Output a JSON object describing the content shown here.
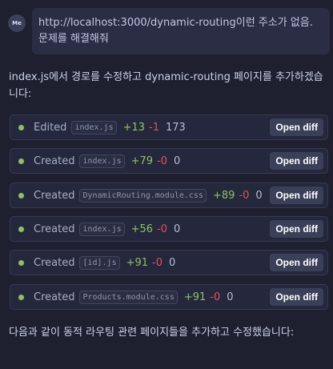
{
  "user": {
    "avatar_label": "Me",
    "message_line1": "http://localhost:3000/dynamic-routing이런 주소가 없음.",
    "message_line2": "문제를 해결해줘"
  },
  "assistant": {
    "intro": "index.js에서 경로를 수정하고 dynamic-routing 페이지를 추가하겠습니다:",
    "outro": "다음과 같이 동적 라우팅 관련 페이지들을 추가하고 수정했습니다:"
  },
  "changes": [
    {
      "action": "Edited",
      "file": "index.js",
      "added": "+13",
      "removed": "-1",
      "total": "173",
      "button": "Open diff"
    },
    {
      "action": "Created",
      "file": "index.js",
      "added": "+79",
      "removed": "-0",
      "total": "0",
      "button": "Open diff"
    },
    {
      "action": "Created",
      "file": "DynamicRouting.module.css",
      "added": "+89",
      "removed": "-0",
      "total": "0",
      "button": "Open diff"
    },
    {
      "action": "Created",
      "file": "index.js",
      "added": "+56",
      "removed": "-0",
      "total": "0",
      "button": "Open diff"
    },
    {
      "action": "Created",
      "file": "[id].js",
      "added": "+91",
      "removed": "-0",
      "total": "0",
      "button": "Open diff"
    },
    {
      "action": "Created",
      "file": "Products.module.css",
      "added": "+91",
      "removed": "-0",
      "total": "0",
      "button": "Open diff"
    }
  ],
  "colors": {
    "added": "#8cc265",
    "removed": "#e0505a",
    "status_dot": "#8fbf6a",
    "background": "#1e2030"
  },
  "icons": {
    "status": "status-dot-icon"
  }
}
